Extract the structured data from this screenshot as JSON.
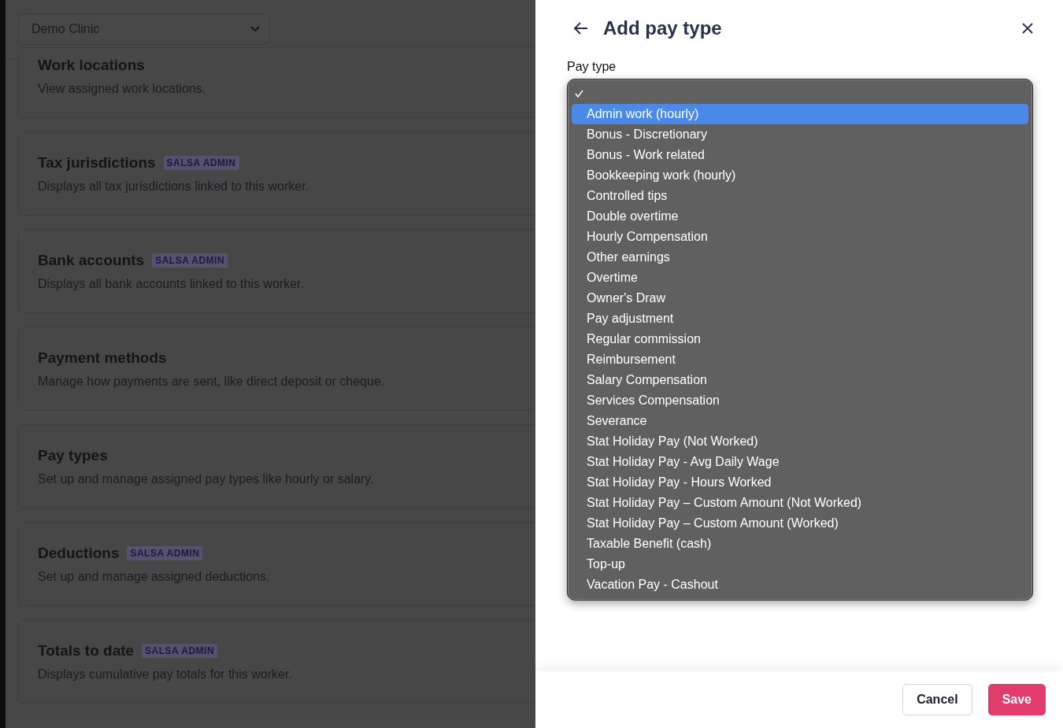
{
  "clinic_select": {
    "value": "Demo Clinic"
  },
  "sections": [
    {
      "title": "Work locations",
      "description": "View assigned work locations."
    },
    {
      "title": "Tax jurisdictions",
      "badge": "SALSA ADMIN",
      "description": "Displays all tax jurisdictions linked to this worker."
    },
    {
      "title": "Bank accounts",
      "badge": "SALSA ADMIN",
      "description": "Displays all bank accounts linked to this worker."
    },
    {
      "title": "Payment methods",
      "description": "Manage how payments are sent, like direct deposit or cheque."
    },
    {
      "title": "Pay types",
      "description": "Set up and manage assigned pay types like hourly or salary."
    },
    {
      "title": "Deductions",
      "badge": "SALSA ADMIN",
      "description": "Set up and manage assigned deductions."
    },
    {
      "title": "Totals to date",
      "badge": "SALSA ADMIN",
      "description": "Displays cumulative pay totals for this worker."
    }
  ],
  "drawer": {
    "title": "Add pay type",
    "field_label": "Pay type",
    "options": [
      {
        "checked": true,
        "selected": false
      },
      {
        "label": "Admin work (hourly)",
        "checked": false,
        "selected": true
      },
      {
        "label": "Bonus - Discretionary",
        "checked": false,
        "selected": false
      },
      {
        "label": "Bonus - Work related",
        "checked": false,
        "selected": false
      },
      {
        "label": "Bookkeeping work (hourly)",
        "checked": false,
        "selected": false
      },
      {
        "label": "Controlled tips",
        "checked": false,
        "selected": false
      },
      {
        "label": "Double overtime",
        "checked": false,
        "selected": false
      },
      {
        "label": "Hourly Compensation",
        "checked": false,
        "selected": false
      },
      {
        "label": "Other earnings",
        "checked": false,
        "selected": false
      },
      {
        "label": "Overtime",
        "checked": false,
        "selected": false
      },
      {
        "label": "Owner's Draw",
        "checked": false,
        "selected": false
      },
      {
        "label": "Pay adjustment",
        "checked": false,
        "selected": false
      },
      {
        "label": "Regular commission",
        "checked": false,
        "selected": false
      },
      {
        "label": "Reimbursement",
        "checked": false,
        "selected": false
      },
      {
        "label": "Salary Compensation",
        "checked": false,
        "selected": false
      },
      {
        "label": "Services Compensation",
        "checked": false,
        "selected": false
      },
      {
        "label": "Severance",
        "checked": false,
        "selected": false
      },
      {
        "label": "Stat Holiday Pay (Not Worked)",
        "checked": false,
        "selected": false
      },
      {
        "label": "Stat Holiday Pay - Avg Daily Wage",
        "checked": false,
        "selected": false
      },
      {
        "label": "Stat Holiday Pay - Hours Worked",
        "checked": false,
        "selected": false
      },
      {
        "label": "Stat Holiday Pay – Custom Amount (Not Worked)",
        "checked": false,
        "selected": false
      },
      {
        "label": "Stat Holiday Pay – Custom Amount (Worked)",
        "checked": false,
        "selected": false
      },
      {
        "label": "Taxable Benefit (cash)",
        "checked": false,
        "selected": false
      },
      {
        "label": "Top-up",
        "checked": false,
        "selected": false
      },
      {
        "label": "Vacation Pay - Cashout",
        "checked": false,
        "selected": false
      }
    ],
    "buttons": [
      {
        "label": "Cancel",
        "kind": "secondary"
      },
      {
        "label": "Save",
        "kind": "primary"
      }
    ]
  }
}
